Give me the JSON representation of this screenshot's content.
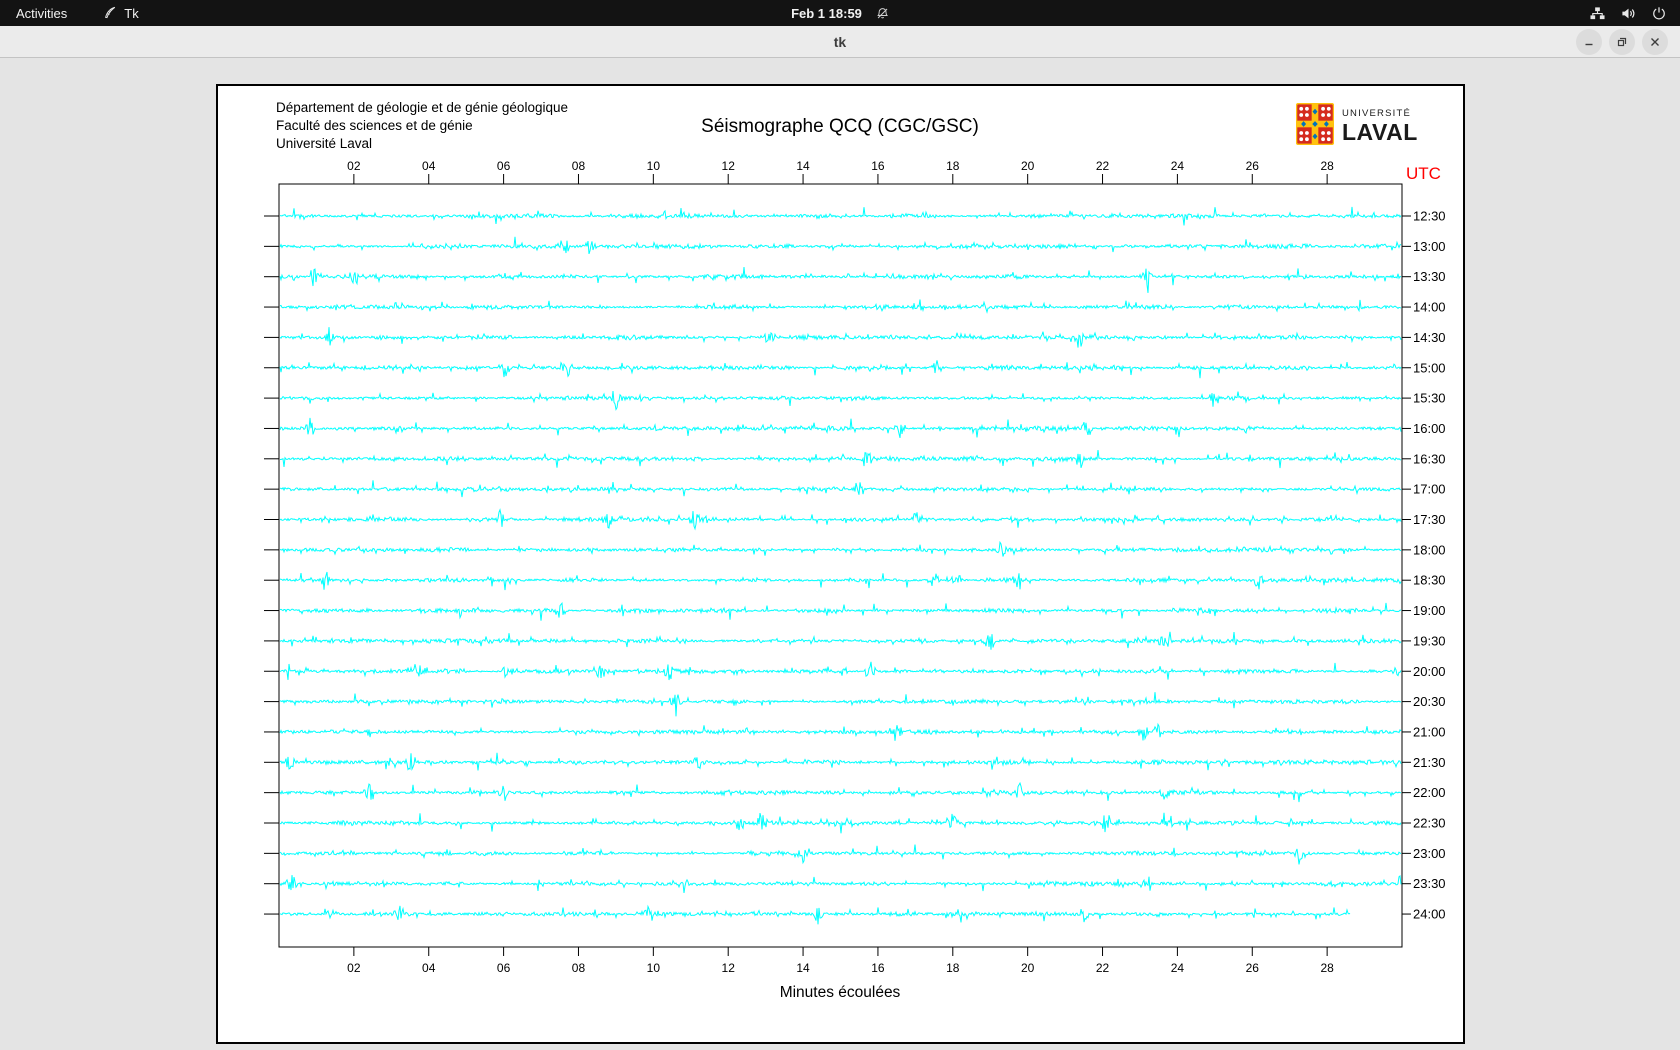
{
  "top_bar": {
    "activities": "Activities",
    "app_name": "Tk",
    "clock": "Feb 1 18:59",
    "icons": [
      "tk-feather",
      "notifications-off",
      "network",
      "volume",
      "power"
    ]
  },
  "window": {
    "title": "tk",
    "controls": [
      "minimize",
      "restore",
      "close"
    ]
  },
  "canvas": {
    "institution_lines": [
      "Département de géologie et de génie géologique",
      "Faculté des sciences et de génie",
      "Université Laval"
    ],
    "title": "Séismographe QCQ (CGC/GSC)",
    "logo": {
      "top": "UNIVERSITÉ",
      "bottom": "LAVAL"
    },
    "utc_label": "UTC",
    "x_ticks": [
      "02",
      "04",
      "06",
      "08",
      "10",
      "12",
      "14",
      "16",
      "18",
      "20",
      "22",
      "24",
      "26",
      "28"
    ],
    "x_label": "Minutes écoulées",
    "rows": [
      {
        "time": "12:30",
        "events": []
      },
      {
        "time": "13:00",
        "events": [
          7.6,
          8.3
        ]
      },
      {
        "time": "13:30",
        "events": [
          0.9,
          2.0,
          23.2
        ]
      },
      {
        "time": "14:00",
        "events": [
          17.1
        ]
      },
      {
        "time": "14:30",
        "events": [
          1.3,
          13.1,
          21.4
        ]
      },
      {
        "time": "15:00",
        "events": [
          6.0,
          7.7,
          17.6
        ]
      },
      {
        "time": "15:30",
        "events": [
          9.0,
          25.0
        ]
      },
      {
        "time": "16:00",
        "events": [
          0.8,
          16.6,
          21.6
        ]
      },
      {
        "time": "16:30",
        "events": [
          15.7,
          21.4
        ]
      },
      {
        "time": "17:00",
        "events": [
          15.5
        ]
      },
      {
        "time": "17:30",
        "events": [
          5.9,
          8.8,
          11.1,
          17.0
        ]
      },
      {
        "time": "18:00",
        "events": [
          19.3
        ]
      },
      {
        "time": "18:30",
        "events": [
          1.2,
          17.5,
          18.1,
          19.8,
          26.2
        ]
      },
      {
        "time": "19:00",
        "events": [
          7.5
        ]
      },
      {
        "time": "19:30",
        "events": [
          19.0,
          23.7
        ]
      },
      {
        "time": "20:00",
        "events": [
          3.7,
          6.1,
          8.6,
          10.4,
          15.8
        ]
      },
      {
        "time": "20:30",
        "events": [
          10.6
        ]
      },
      {
        "time": "21:00",
        "events": [
          16.5,
          23.1,
          23.5
        ]
      },
      {
        "time": "21:30",
        "events": [
          0.3,
          3.5,
          11.2
        ]
      },
      {
        "time": "22:00",
        "events": [
          2.4,
          6.0,
          19.8,
          23.7
        ]
      },
      {
        "time": "22:30",
        "events": [
          12.3,
          12.9,
          18.0,
          22.1,
          23.8
        ]
      },
      {
        "time": "23:00",
        "events": [
          14.0,
          27.3
        ]
      },
      {
        "time": "23:30",
        "events": [
          0.3,
          10.8,
          23.2
        ]
      },
      {
        "time": "24:00",
        "events": [
          1.3,
          3.2,
          9.9,
          14.4,
          21.5
        ],
        "extent": 0.955
      }
    ]
  },
  "colors": {
    "trace": "#00ffff",
    "utc_label": "#ff0000",
    "logo_red": "#d52b1e",
    "logo_yellow": "#ffc20e",
    "logo_blue": "#0072bc"
  }
}
